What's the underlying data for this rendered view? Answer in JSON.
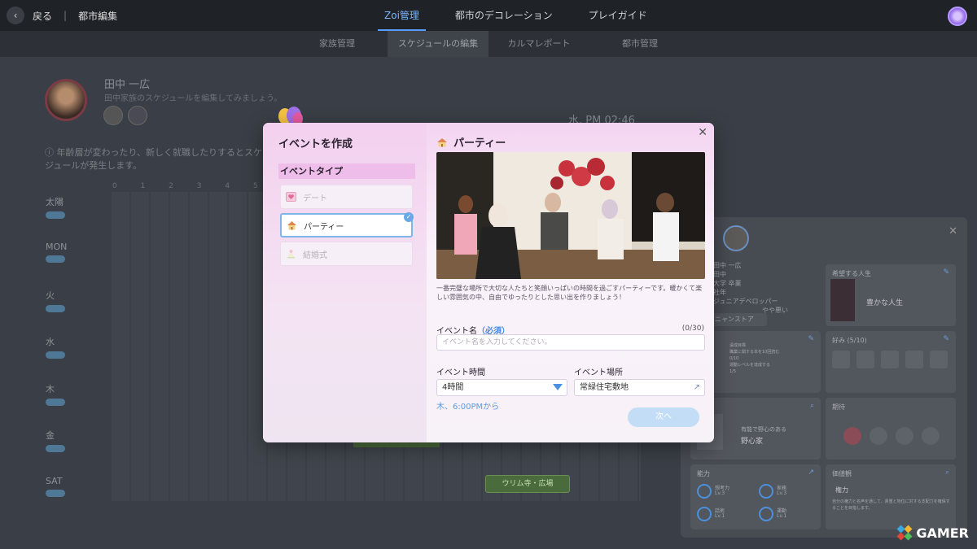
{
  "topbar": {
    "back_label": "戻る",
    "separator": "|",
    "crumb": "都市編集",
    "tabs": [
      {
        "label": "Zoi管理",
        "active": true
      },
      {
        "label": "都市のデコレーション",
        "active": false
      },
      {
        "label": "プレイガイド",
        "active": false
      }
    ]
  },
  "subtabs": [
    {
      "label": "家族管理",
      "active": false
    },
    {
      "label": "スケジュールの編集",
      "active": true
    },
    {
      "label": "カルマレポート",
      "active": false
    },
    {
      "label": "都市管理",
      "active": false
    }
  ],
  "background": {
    "character_name": "田中 一広",
    "character_sub": "田中家族のスケジュールを編集してみましょう。",
    "time": "水, PM 02:46",
    "notice": "ⓘ 年齢層が変わったり、新しく就職したりするとスケジュールが発生します。",
    "days": [
      "太陽",
      "MON",
      "火",
      "水",
      "木",
      "金",
      "SAT"
    ],
    "hours": "0 1 2 3 4 5 6",
    "event_tag": "ウリム寺・広場"
  },
  "profile_panel": {
    "info_lines": [
      "田中 一広",
      "田中",
      "大学 卒業",
      "社年",
      "ジュニアデベロッパー",
      "やや悪い"
    ],
    "store_label": "ニャンストア",
    "wish_title": "希望する人生",
    "wish_value": "豊かな人生",
    "likes_title": "好み",
    "likes_count": "(5/10)",
    "career_lines": [
      "遠成目標",
      "職業に関する本を10回読む",
      "0/10",
      "運動レベルを達成する",
      "1/5"
    ],
    "career_tag": "スタ",
    "personality_line": "有能で野心のある",
    "personality_value": "野心家",
    "expect_title": "期待",
    "ability_title": "能力",
    "abilities": [
      {
        "name": "想考力",
        "level": "Lv.3"
      },
      {
        "name": "家務",
        "level": "Lv.3"
      },
      {
        "name": "話術",
        "level": "Lv.1"
      },
      {
        "name": "運動",
        "level": "Lv.1"
      }
    ],
    "values_title": "価値観",
    "value_name": "権力",
    "value_desc": "自分の権力と名声を通して、貴重と地位に対する支配力を確保することを目指します。"
  },
  "modal": {
    "title": "イベントを作成",
    "type_heading": "イベントタイプ",
    "types": [
      {
        "label": "デート",
        "selected": false,
        "icon": "heart-card-icon"
      },
      {
        "label": "パーティー",
        "selected": true,
        "icon": "party-house-icon"
      },
      {
        "label": "結婚式",
        "selected": false,
        "icon": "wedding-icon"
      }
    ],
    "check_mark": "✓",
    "close": "✕",
    "event_title": "パーティー",
    "description": "一番完璧な場所で大切な人たちと笑顔いっぱいの時間を過ごすパーティーです。暖かくて楽しい雰囲気の中、自由でゆったりとした思い出を作りましょう！",
    "name_label": "イベント名",
    "name_required": "（必須）",
    "name_counter": "(0/30)",
    "name_placeholder": "イベント名を入力してください。",
    "time_label": "イベント時間",
    "time_value": "4時間",
    "place_label": "イベント場所",
    "place_value": "常緑住宅敷地",
    "from_text": "木、6:00PMから",
    "next_label": "次へ"
  },
  "watermark": "GAMER",
  "colors": {
    "accent": "#5b9cff",
    "modal_pink": "#f3d0ef",
    "selected_border": "#7eb6ea",
    "next_button": "#c4ddf6"
  }
}
